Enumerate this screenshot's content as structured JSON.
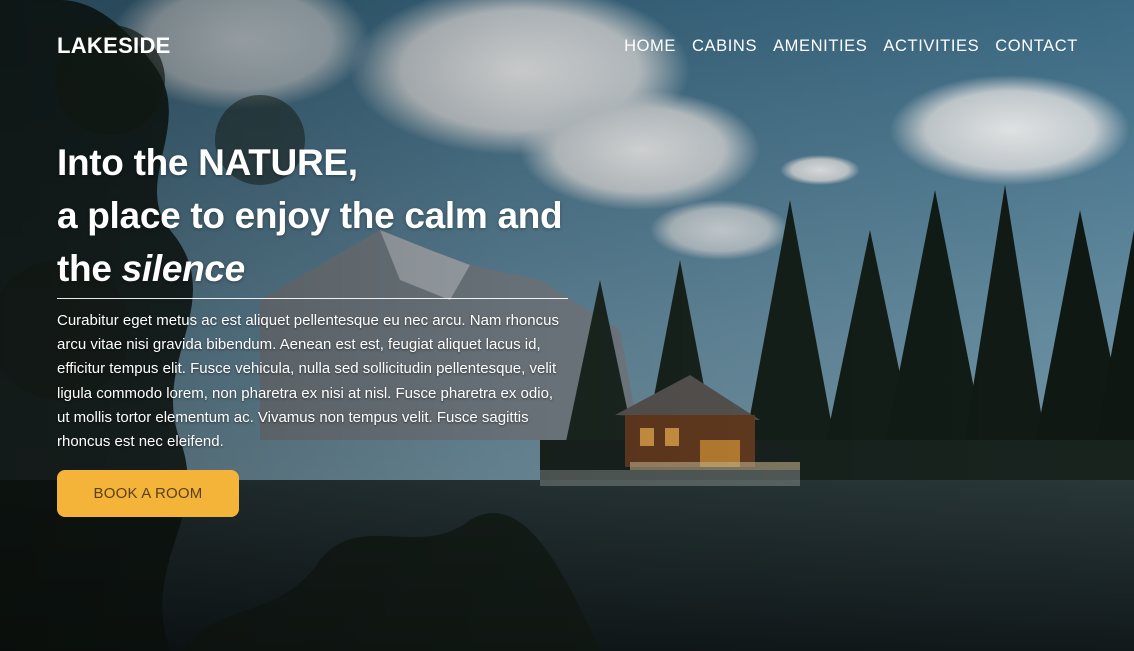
{
  "brand": {
    "logo": "LAKESIDE"
  },
  "nav": {
    "items": [
      {
        "label": "HOME"
      },
      {
        "label": "CABINS"
      },
      {
        "label": "AMENITIES"
      },
      {
        "label": "ACTIVITIES"
      },
      {
        "label": "CONTACT"
      }
    ]
  },
  "hero": {
    "line1": "Into the NATURE,",
    "line2": "a place to enjoy the calm and",
    "line3_prefix": "the ",
    "line3_emphasis": "silence",
    "body": "Curabitur eget metus ac est aliquet pellentesque eu nec arcu. Nam rhoncus arcu vitae nisi gravida bibendum. Aenean est est, feugiat aliquet lacus id, efficitur tempus elit. Fusce vehicula, nulla sed sollicitudin pellentesque, velit ligula commodo lorem, non pharetra ex nisi at nisl. Fusce pharetra ex odio, ut mollis tortor elementum ac. Vivamus non tempus velit. Fusce sagittis rhoncus est nec eleifend.",
    "cta_label": "BOOK A ROOM"
  },
  "colors": {
    "accent": "#f4b43a",
    "text": "#ffffff"
  }
}
